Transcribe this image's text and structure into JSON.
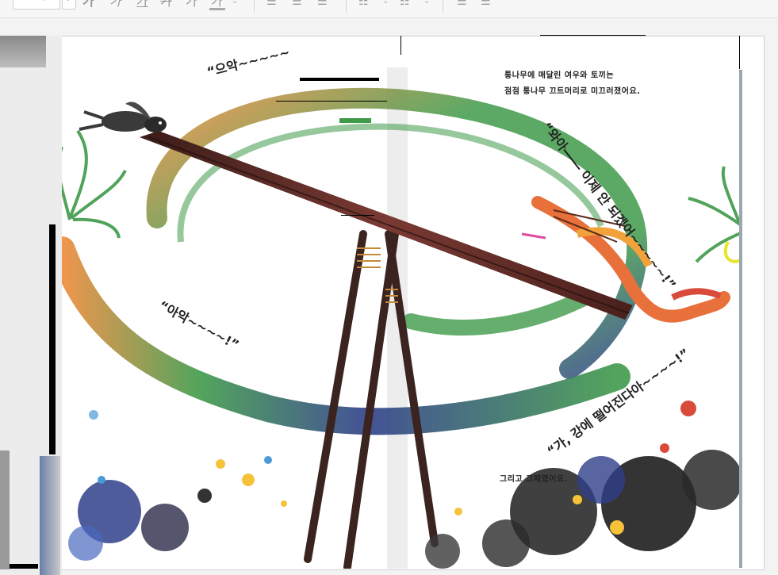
{
  "toolbar": {
    "font_size_unit": "pt",
    "bold_glyph": "가",
    "italic_glyph": "가",
    "underline_glyph": "가",
    "strike_glyph": "가",
    "superscript_glyph": "가",
    "font_color_glyph": "가"
  },
  "story": {
    "narration_1_line1": "통나무에 매달린 여우와 토끼는",
    "narration_1_line2": "점점 통나무 끄트머리로 미끄러졌어요.",
    "narration_2": "그리고 그때였어요.",
    "shout_rabbit": "“으악~~~~~",
    "shout_fox_1": "“와아―― 이제 안 되겠어~~~~~!”",
    "shout_ah": "“아악~~~~!”",
    "shout_fox_2": "“가, 강에 떨어진다아~~~~!”"
  },
  "colors": {
    "green": "#3f9a4a",
    "orange": "#f08a3a",
    "blue": "#2f3f8a",
    "log": "#6b2f2a",
    "fox": "#e8703a"
  }
}
